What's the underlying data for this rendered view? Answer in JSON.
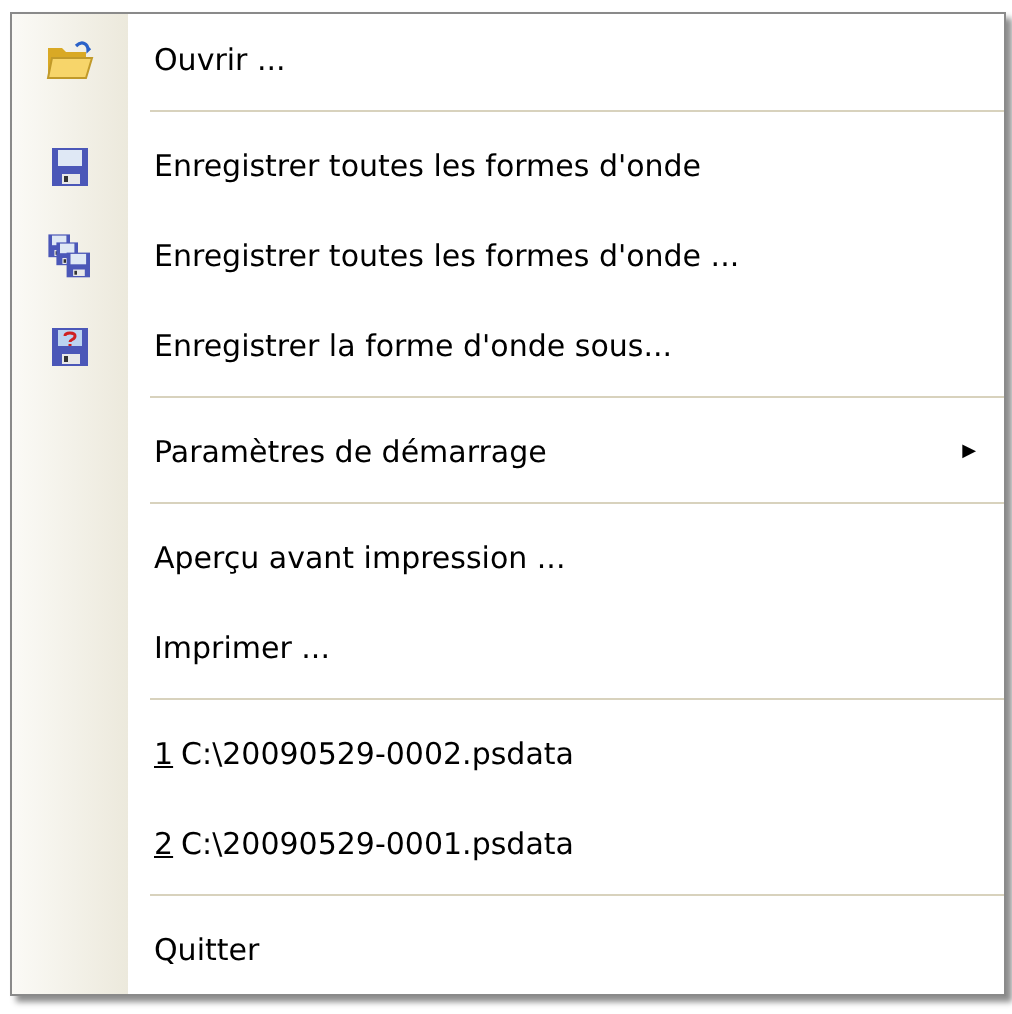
{
  "menu": {
    "groups": [
      {
        "items": [
          {
            "label": "Ouvrir ..."
          }
        ]
      },
      {
        "items": [
          {
            "label": "Enregistrer toutes les formes d'onde"
          },
          {
            "label": "Enregistrer toutes les formes d'onde ..."
          },
          {
            "label": "Enregistrer la forme d'onde sous..."
          }
        ]
      },
      {
        "items": [
          {
            "label": "Paramètres de démarrage",
            "submenu": "▶"
          }
        ]
      },
      {
        "items": [
          {
            "label": "Aperçu avant impression ..."
          },
          {
            "label": "Imprimer ..."
          }
        ]
      },
      {
        "items": [
          {
            "accelerator": "1",
            "label": "C:\\20090529-0002.psdata"
          },
          {
            "accelerator": "2",
            "label": "C:\\20090529-0001.psdata"
          }
        ]
      },
      {
        "items": [
          {
            "label": "Quitter"
          }
        ]
      }
    ]
  }
}
